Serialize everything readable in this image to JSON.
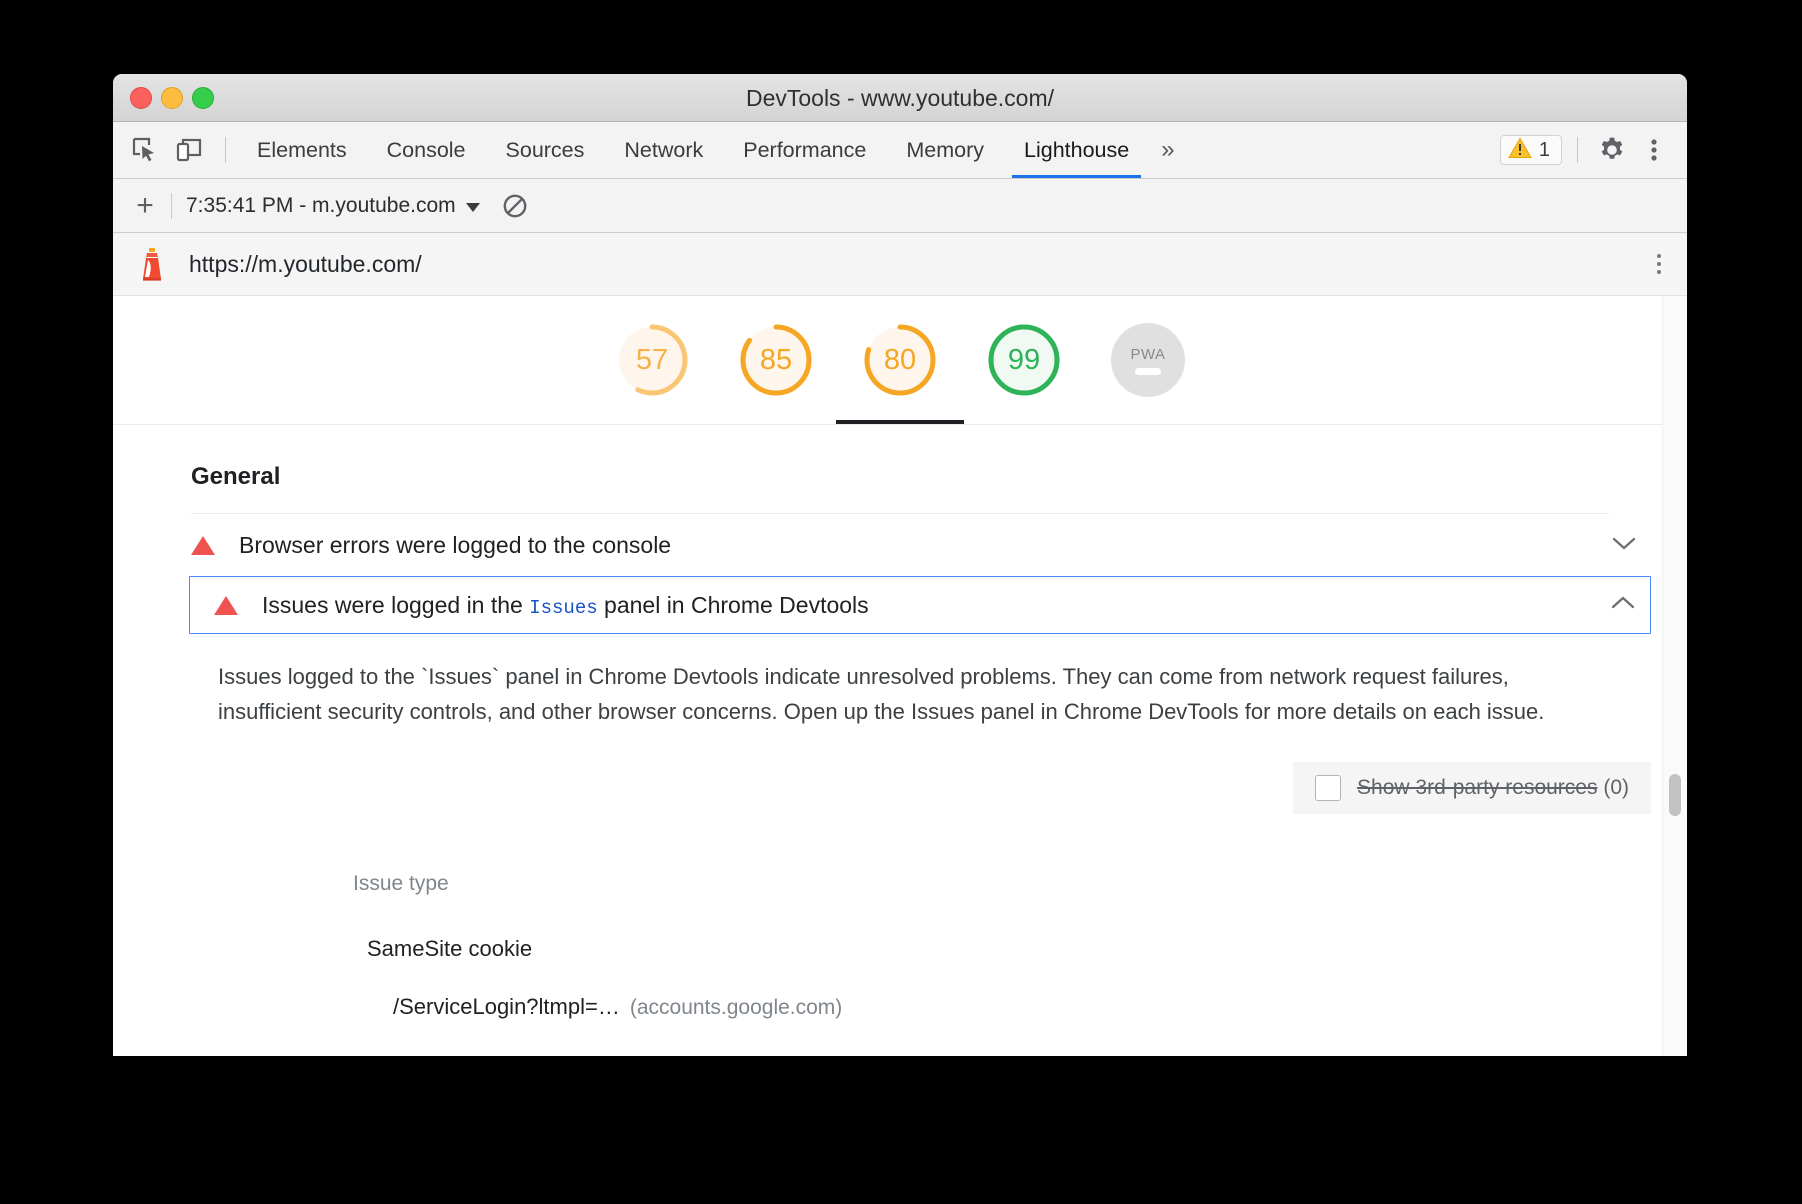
{
  "window": {
    "title": "DevTools - www.youtube.com/",
    "traffic_lights": [
      "close",
      "minimize",
      "zoom"
    ]
  },
  "toolbar": {
    "inspect_icon": "inspect-cursor-icon",
    "device_icon": "device-toggle-icon",
    "tabs": [
      {
        "label": "Elements",
        "selected": false
      },
      {
        "label": "Console",
        "selected": false
      },
      {
        "label": "Sources",
        "selected": false
      },
      {
        "label": "Network",
        "selected": false
      },
      {
        "label": "Performance",
        "selected": false
      },
      {
        "label": "Memory",
        "selected": false
      },
      {
        "label": "Lighthouse",
        "selected": true
      }
    ],
    "more_tabs_label": "»",
    "warning_count": "1",
    "warning_icon": "warning-triangle-icon",
    "settings_icon": "gear-icon",
    "menu_icon": "more-vertical-icon"
  },
  "runbar": {
    "new_run_label": "+",
    "selected_run": "7:35:41 PM - m.youtube.com",
    "dropdown_icon": "chevron-down-icon",
    "clear_icon": "clear-all-icon"
  },
  "report_header": {
    "logo_icon": "lighthouse-icon",
    "url": "https://m.youtube.com/",
    "menu_icon": "more-vertical-icon"
  },
  "scores": [
    {
      "name": "performance",
      "value": "57",
      "color": "#f5a623",
      "faded": true,
      "selected": false,
      "pct": 57
    },
    {
      "name": "accessibility",
      "value": "85",
      "color": "#f5a623",
      "faded": false,
      "selected": false,
      "pct": 85
    },
    {
      "name": "best-practices",
      "value": "80",
      "color": "#f5a623",
      "faded": false,
      "selected": true,
      "pct": 80
    },
    {
      "name": "seo",
      "value": "99",
      "color": "#2eb358",
      "faded": false,
      "selected": false,
      "pct": 99
    },
    {
      "name": "pwa",
      "value": "PWA",
      "color": "#e0e0e0",
      "faded": false,
      "selected": false,
      "pct": 0
    }
  ],
  "section": {
    "title": "General"
  },
  "audits": [
    {
      "title": "Browser errors were logged to the console",
      "icon": "warning-triangle-icon",
      "expanded": false,
      "chevron": "chevron-down-icon"
    },
    {
      "title_before": "Issues were logged in the",
      "title_code": "Issues",
      "title_after": "panel in Chrome Devtools",
      "icon": "warning-triangle-icon",
      "expanded": true,
      "chevron": "chevron-up-icon",
      "description": "Issues logged to the `Issues` panel in Chrome Devtools indicate unresolved problems. They can come from network request failures, insufficient security controls, and other browser concerns. Open up the Issues panel in Chrome DevTools for more details on each issue.",
      "third_party": {
        "label": "Show 3rd-party resources",
        "count": "(0)",
        "checked": false
      },
      "table": {
        "column_header": "Issue type",
        "groups": [
          {
            "name": "SameSite cookie",
            "rows": [
              {
                "path": "/ServiceLogin?ltmpl=…",
                "host": "(accounts.google.com)"
              }
            ]
          }
        ]
      }
    }
  ],
  "scrollbar": {
    "name": "vertical-scrollbar"
  }
}
